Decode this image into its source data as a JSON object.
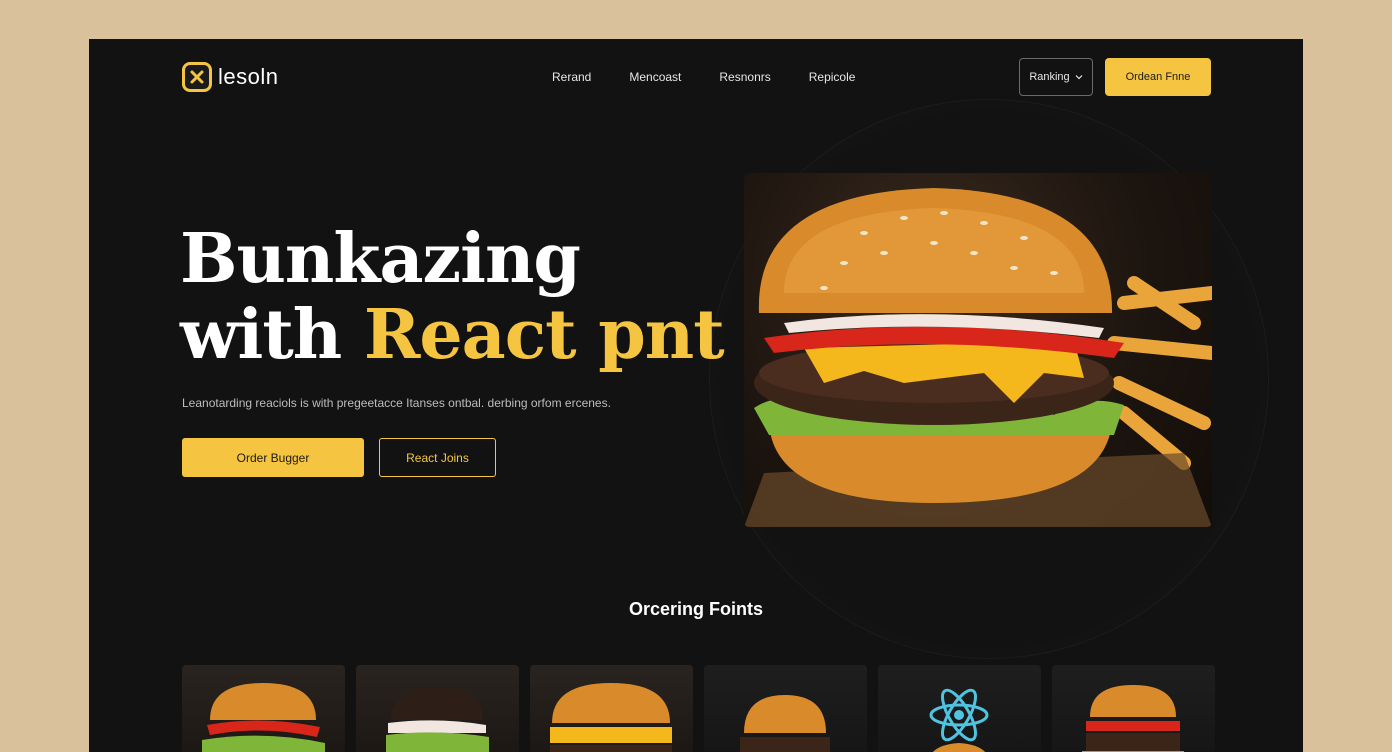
{
  "header": {
    "logo_text": "lesoln",
    "logo_icon": "x-icon",
    "nav": [
      {
        "label": "Rerand"
      },
      {
        "label": "Mencoast"
      },
      {
        "label": "Resnonrs"
      },
      {
        "label": "Repicole"
      }
    ],
    "ranking_select": {
      "label": "Ranking",
      "icon": "chevron-down-icon"
    },
    "order_button": "Ordean Fnne"
  },
  "hero": {
    "title_line1": "Bunkazing",
    "title_line2_white": "with ",
    "title_line2_accent": "React pnt",
    "subtitle": "Leanotarding reaciols is with pregeetacce Itanses ontbal. derbing orfom ercenes.",
    "primary_button": "Order Bugger",
    "secondary_button": "React Joins",
    "image": "burger-with-fries-photo"
  },
  "section": {
    "title": "Orcering Foints",
    "cards": [
      {
        "image": "burger-card-1"
      },
      {
        "image": "burger-card-2"
      },
      {
        "image": "burger-card-3"
      },
      {
        "image": "burger-card-4"
      },
      {
        "image": "react-atom-card"
      },
      {
        "image": "burger-card-6"
      }
    ]
  },
  "colors": {
    "background": "#d9c19c",
    "window": "#121212",
    "accent": "#f5c542",
    "text": "#ffffff"
  }
}
